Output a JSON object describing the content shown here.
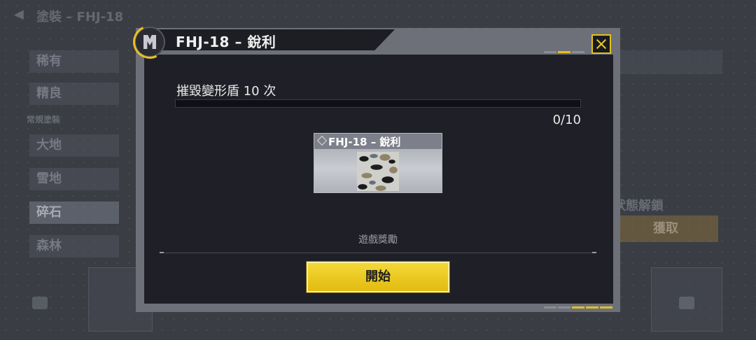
{
  "background": {
    "back_title": "塗裝 – FHJ-18",
    "tabs": [
      "稀有",
      "精良",
      "大地",
      "雪地",
      "碎石",
      "森林"
    ],
    "category_label": "常規塗裝",
    "right_label": "狀態解鎖",
    "right_button": "獲取"
  },
  "dialog": {
    "title": "FHJ-18 – 銳利",
    "task": "摧毀變形盾 10 次",
    "progress": {
      "current": 0,
      "total": 10,
      "text": "0/10"
    },
    "reward": {
      "name": "FHJ-18 – 銳利",
      "caption": "遊戲獎勵"
    },
    "start_label": "開始"
  },
  "icons": {
    "emblem": "mode-emblem-icon",
    "close": "close-icon",
    "diamond": "rarity-diamond-icon",
    "lock": "lock-icon"
  },
  "colors": {
    "accent": "#e0c020",
    "panel": "#1f2027",
    "frame": "#6e7079"
  }
}
